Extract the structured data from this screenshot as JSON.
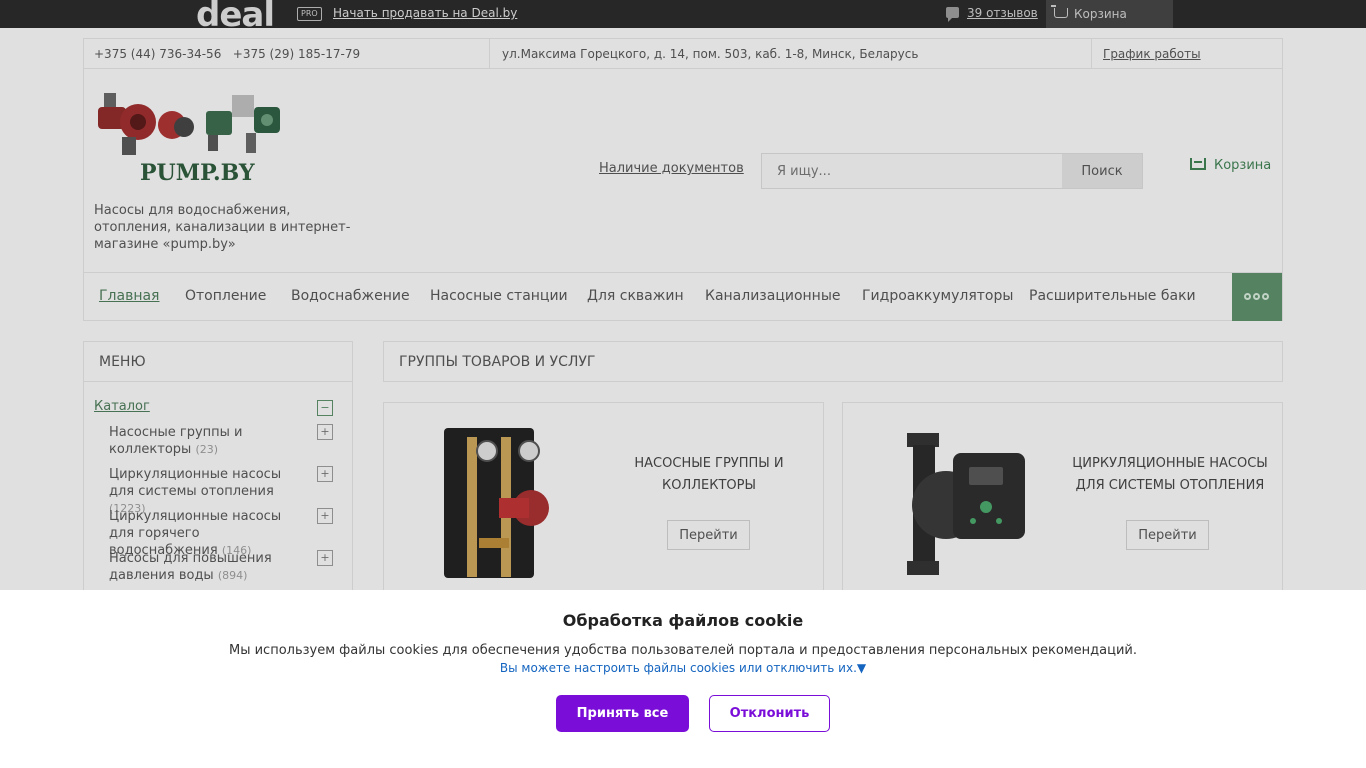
{
  "topbar": {
    "logo": "deal",
    "pro_badge": "PRO",
    "sell_link": "Начать продавать на Deal.by",
    "reviews": "39 отзывов",
    "cart": "Корзина"
  },
  "contacts": {
    "phone1": "+375 (44) 736-34-56",
    "phone2": "+375 (29) 185-17-79",
    "address": "ул.Максима Горецкого, д. 14, пом. 503, каб. 1-8, Минск, Беларусь",
    "schedule": "График работы"
  },
  "header": {
    "logo_text": "PUMP.BY",
    "slogan": "Насосы для водоснабжения, отопления, канализации в интернет-магазине «pump.by»",
    "docs_link": "Наличие документов",
    "search_placeholder": "Я ищу...",
    "search_button": "Поиск",
    "cart": "Корзина"
  },
  "nav": {
    "items": [
      "Главная",
      "Отопление",
      "Водоснабжение",
      "Насосные станции",
      "Для скважин",
      "Канализационные",
      "Гидроаккумуляторы",
      "Расширительные баки"
    ]
  },
  "sidebar": {
    "title": "МЕНЮ",
    "catalog": "Каталог",
    "items": [
      {
        "label": "Насосные группы и коллекторы",
        "count": "(23)"
      },
      {
        "label": "Циркуляционные насосы для системы отопления",
        "count": "(1223)"
      },
      {
        "label": "Циркуляционные насосы для горячего водоснабжения",
        "count": "(146)"
      },
      {
        "label": "Насосы для повышения давления воды",
        "count": "(894)"
      }
    ]
  },
  "content": {
    "title": "ГРУППЫ ТОВАРОВ И УСЛУГ",
    "cards": [
      {
        "name": "НАСОСНЫЕ ГРУППЫ И КОЛЛЕКТОРЫ",
        "button": "Перейти"
      },
      {
        "name": "ЦИРКУЛЯЦИОННЫЕ НАСОСЫ ДЛЯ СИСТЕМЫ ОТОПЛЕНИЯ",
        "button": "Перейти"
      }
    ]
  },
  "cookie": {
    "title": "Обработка файлов cookie",
    "text": "Мы используем файлы cookies для обеспечения удобства пользователей портала и предоставления персональных рекомендаций.",
    "settings_link": "Вы можете настроить файлы cookies или отключить их.▼",
    "accept": "Принять все",
    "decline": "Отклонить"
  },
  "colors": {
    "brand_green": "#5c8c68",
    "accent_purple": "#7a0ed8",
    "link_blue": "#1565c0",
    "topbar": "#2b2b2b"
  }
}
